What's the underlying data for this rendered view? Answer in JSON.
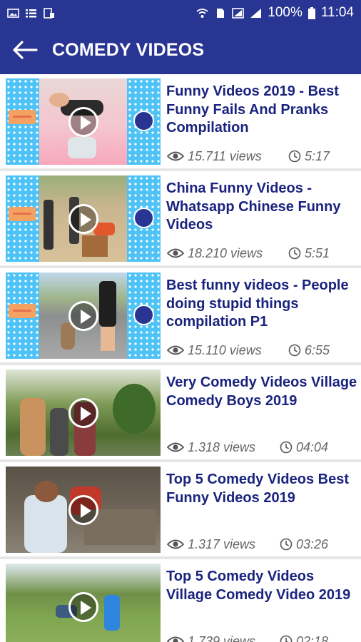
{
  "status_bar": {
    "battery": "100%",
    "time": "11:04"
  },
  "toolbar": {
    "title": "COMEDY VIDEOS"
  },
  "videos": [
    {
      "title": "Funny Videos 2019 - Best Funny Fails And Pranks Compilation",
      "views": "15.711 views",
      "duration": "5:17"
    },
    {
      "title": "China Funny Videos - Whatsapp Chinese Funny Videos",
      "views": "18.210 views",
      "duration": "5:51"
    },
    {
      "title": "Best funny videos - People doing stupid things compilation P1",
      "views": "15.110 views",
      "duration": "6:55"
    },
    {
      "title": "Very Comedy Videos Village Comedy Boys 2019",
      "views": "1.318 views",
      "duration": "04:04"
    },
    {
      "title": "Top 5 Comedy Videos Best Funny Videos 2019",
      "views": "1.317 views",
      "duration": "03:26"
    },
    {
      "title": "Top 5 Comedy Videos Village Comedy Video 2019",
      "views": "1.739 views",
      "duration": "02:18"
    }
  ],
  "colors": {
    "app_bar": "#283593",
    "title_text": "#1a237e",
    "meta_text": "#666666",
    "thumb_frame": "#4fc3f7"
  },
  "icons": {
    "back": "arrow-left-icon",
    "views": "eye-icon",
    "duration": "clock-icon",
    "play": "play-icon"
  }
}
